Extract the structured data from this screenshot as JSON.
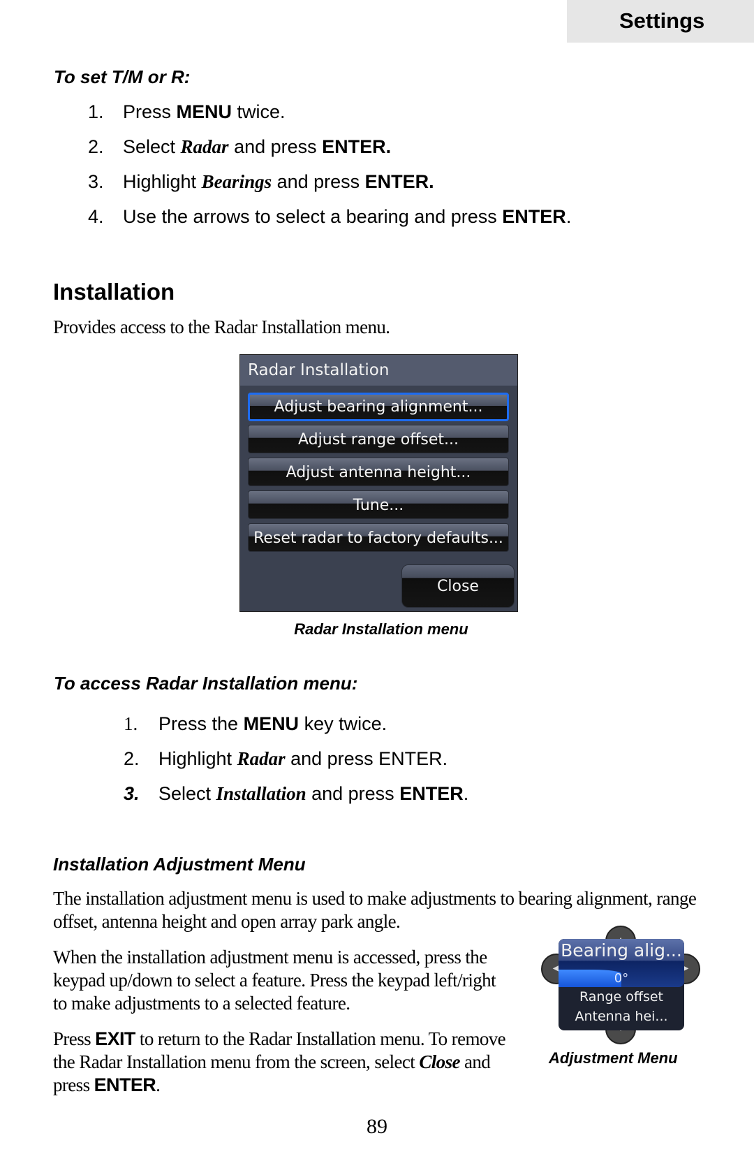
{
  "header": {
    "section_tab": "Settings"
  },
  "tm_section": {
    "heading": "To set T/M or R:",
    "steps": [
      {
        "num": "1.",
        "pre": "Press ",
        "bold": "MENU",
        "post": " twice."
      },
      {
        "num": "2.",
        "pre": "Select ",
        "italic": "Radar",
        "mid": " and press ",
        "bold": "ENTER."
      },
      {
        "num": "3.",
        "pre": "Highlight ",
        "italic": "Bearings",
        "mid": " and press ",
        "bold": "ENTER."
      },
      {
        "num": "4.",
        "pre": "Use the arrows to select a bearing and press ",
        "bold": "ENTER",
        "post": "."
      }
    ]
  },
  "installation": {
    "title": "Installation",
    "description": "Provides access to the Radar Installation menu."
  },
  "radar_menu": {
    "title": "Radar Installation",
    "items": [
      {
        "label": "Adjust bearing alignment...",
        "selected": true
      },
      {
        "label": "Adjust range offset...",
        "selected": false
      },
      {
        "label": "Adjust antenna height...",
        "selected": false
      },
      {
        "label": "Tune...",
        "selected": false
      },
      {
        "label": "Reset radar to factory defaults...",
        "selected": false
      }
    ],
    "close_label": "Close",
    "caption": "Radar Installation menu",
    "accent_color": "#1e6cf0"
  },
  "access_section": {
    "heading": "To access Radar Installation menu:",
    "steps": [
      {
        "num": "1.",
        "pre": "Press the ",
        "bold": "MENU",
        "post": " key twice."
      },
      {
        "num": "2.",
        "pre": "Highlight ",
        "italic": "Radar",
        "post": " and press ENTER."
      },
      {
        "num": "3.",
        "pre": "Select ",
        "italic": "Installation",
        "mid": " and press ",
        "bold": "ENTER",
        "post": "."
      }
    ]
  },
  "adjustment_section": {
    "heading": "Installation Adjustment Menu",
    "para1": "The installation adjustment menu is used to make adjustments to bearing alignment, range offset, antenna height and open array park angle.",
    "para2_lines": [
      "When the installation adjustment menu is accessed, press the",
      "keypad up/down to select a feature. Press the keypad left/right",
      "to make adjustments to a selected feature."
    ],
    "para3": {
      "l1_pre": "Press ",
      "l1_bold": "EXIT",
      "l1_post": " to return to the Radar Installation menu. To remove",
      "l2_pre": "the Radar Installation menu from the screen, select ",
      "l2_italic": "Close",
      "l2_post": " and",
      "l3_pre": "press ",
      "l3_bold": "ENTER",
      "l3_post": "."
    }
  },
  "adjustment_widget": {
    "selected_label": "Bearing alig...",
    "value": "0°",
    "value_fraction": 0.5,
    "other_items": [
      "Range offset",
      "Antenna hei..."
    ],
    "arrows": {
      "up": "▲",
      "down": "▼",
      "left": "◀",
      "right": "▶"
    },
    "caption": "Adjustment Menu"
  },
  "footer": {
    "page_number": "89"
  }
}
